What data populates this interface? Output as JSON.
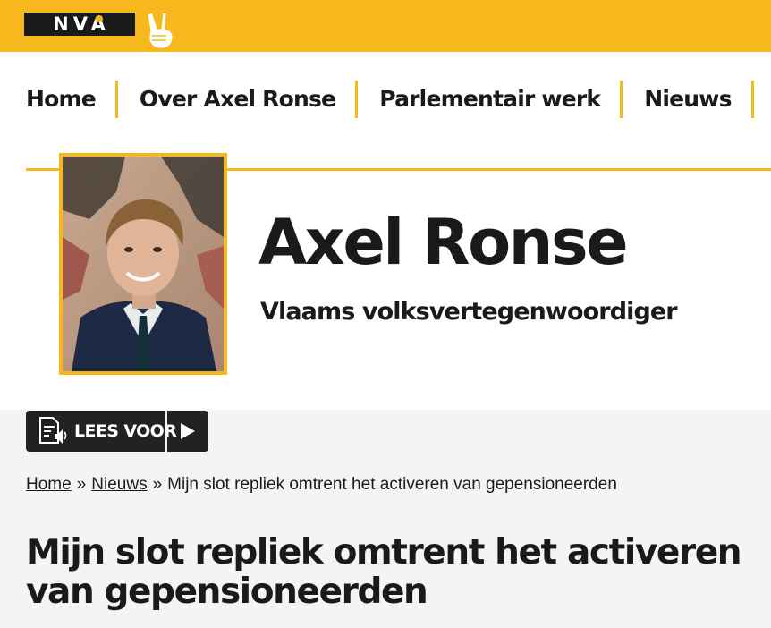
{
  "brand": {
    "logo_text": "NVA",
    "color_yellow": "#f6b81c",
    "color_dark": "#1a1a1a",
    "victory_icon": "victory-hand-icon"
  },
  "nav": {
    "items": [
      {
        "label": "Home"
      },
      {
        "label": "Over Axel Ronse"
      },
      {
        "label": "Parlementair werk"
      },
      {
        "label": "Nieuws"
      }
    ]
  },
  "hero": {
    "name": "Axel Ronse",
    "role": "Vlaams volksvertegenwoordiger",
    "portrait_icon": "portrait-photo"
  },
  "readspeaker": {
    "label": "LEES VOOR",
    "icon": "document-speaker-icon",
    "play_icon": "play-icon"
  },
  "breadcrumb": {
    "home": "Home",
    "sep": "»",
    "news": "Nieuws",
    "current": "Mijn slot repliek omtrent het activeren van gepensioneerden"
  },
  "article": {
    "title": "Mijn slot repliek omtrent het activeren van gepensioneerden"
  }
}
